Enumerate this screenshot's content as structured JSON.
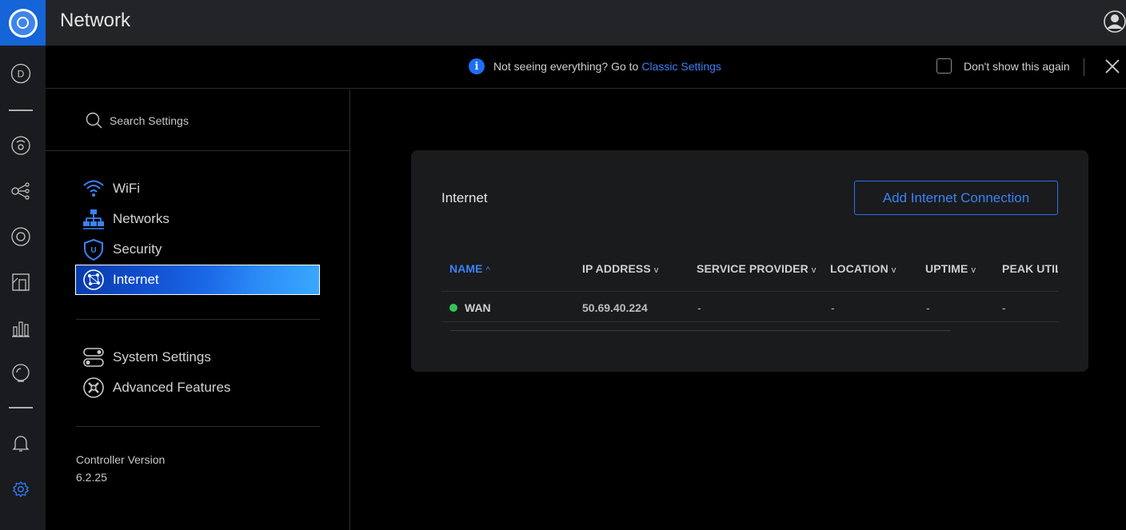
{
  "topbar": {
    "title": "Network"
  },
  "rail": {
    "user_initial": "D"
  },
  "banner": {
    "message": "Not seeing everything? Go to",
    "link_text": "Classic Settings",
    "info_glyph": "i",
    "dont_show_label": "Don't show this again"
  },
  "sidenav": {
    "search_placeholder": "Search Settings",
    "items": [
      {
        "label": "WiFi",
        "icon": "wifi-icon"
      },
      {
        "label": "Networks",
        "icon": "networks-icon"
      },
      {
        "label": "Security",
        "icon": "security-shield-icon"
      },
      {
        "label": "Internet",
        "icon": "internet-globe-icon",
        "active": true
      }
    ],
    "secondary_items": [
      {
        "label": "System Settings",
        "icon": "system-settings-icon"
      },
      {
        "label": "Advanced Features",
        "icon": "advanced-features-icon"
      }
    ],
    "controller_version_label": "Controller Version",
    "controller_version": "6.2.25"
  },
  "main": {
    "card_title": "Internet",
    "add_button_label": "Add Internet Connection",
    "table": {
      "columns": [
        "NAME",
        "IP ADDRESS",
        "SERVICE PROVIDER",
        "LOCATION",
        "UPTIME",
        "PEAK UTIL"
      ],
      "sort_up_glyph": "^",
      "sort_down_glyph": "v",
      "rows": [
        {
          "name": "WAN",
          "ip": "50.69.40.224",
          "provider": "-",
          "location": "-",
          "uptime": "-",
          "peak": "-",
          "status_color": "#35c45b"
        }
      ]
    }
  },
  "colors": {
    "accent": "#3b82f6",
    "logo_bg": "#1565d8",
    "online": "#35c45b"
  }
}
